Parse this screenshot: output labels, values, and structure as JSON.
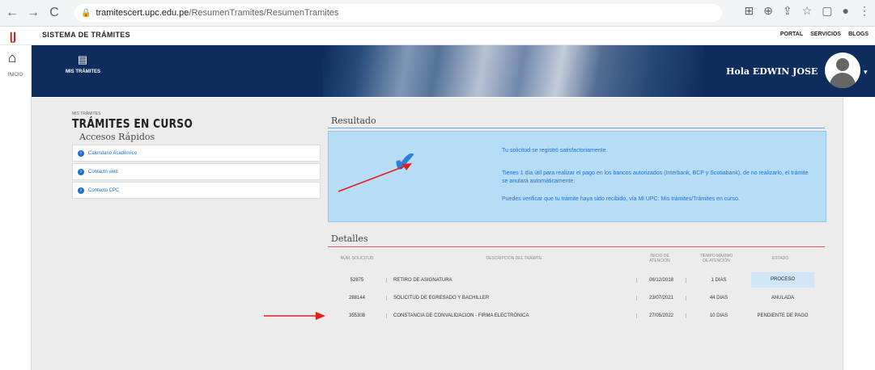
{
  "browser": {
    "url_host": "tramitescert.upc.edu.pe",
    "url_path": "/ResumenTramites/ResumenTramites",
    "back": "←",
    "forward": "→",
    "reload": "C"
  },
  "app": {
    "system_title": "SISTEMA DE TRÁMITES",
    "top_links": [
      "PORTAL",
      "SERVICIOS",
      "BLOGS"
    ],
    "home_label": "INICIO",
    "my_tramite_label": "MIS TRÁMITES",
    "greeting": "Hola EDWIN JOSE"
  },
  "page": {
    "breadcrumb": "MIS TRÁMITES",
    "title": "TRÁMITES EN CURSO",
    "quick_access_title": "Accesos Rápidos",
    "quick_links": [
      "Calendario Académico",
      "Contacto web",
      "Contacto CPC"
    ]
  },
  "result": {
    "title": "Resultado",
    "message1": "Tu solicitud se registró satisfactoriamente.",
    "message2a": "Tienes 1 día útil para realizar el pago en los bancos autorizados (Interbank, BCP y Scotiabank), de no realizarlo, el trámite",
    "message2b": "se anulará automáticamente.",
    "message3": "Puedes verificar que tu trámite haya sido recibido, vía Mi UPC: Mis trámites/Trámites en curso."
  },
  "details": {
    "title": "Detalles",
    "headers": {
      "n_solicitud": "NÚM. SOLICITUD",
      "descripcion": "DESCRIPCIÓN DEL TRÁMITE",
      "inicio_a": "INICIO DE",
      "inicio_b": "ATENCIÓN",
      "tiempo_a": "TIEMPO MÁXIMO",
      "tiempo_b": "DE ATENCIÓN",
      "estado": "ESTADO"
    },
    "rows": [
      {
        "num": "52875",
        "desc": "RETIRO DE ASIGNATURA",
        "inicio": "06/12/2018",
        "tiempo": "1 DIAS",
        "estado": "PROCESO"
      },
      {
        "num": "288144",
        "desc": "SOLICITUD DE EGRESADO Y BACHILLER",
        "inicio": "23/07/2021",
        "tiempo": "44 DIAS",
        "estado": "ANULADA"
      },
      {
        "num": "355308",
        "desc": "CONSTANCIA DE CONVALIDACION - FIRMA ELECTRÓNICA",
        "inicio": "27/05/2022",
        "tiempo": "10 DIAS",
        "estado": "PENDIENTE DE PAGO"
      }
    ]
  },
  "colors": {
    "banner": "#0e2d5c",
    "accent_blue": "#1f6fd1",
    "result_bg": "#b7dcf6",
    "annotation_red": "#e02020"
  }
}
